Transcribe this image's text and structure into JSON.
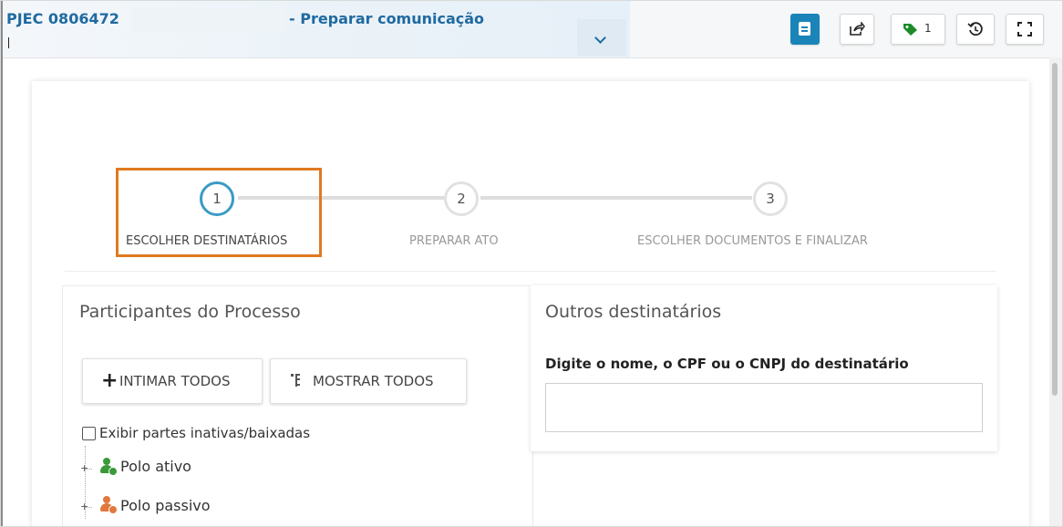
{
  "header": {
    "process_number": "PJEC 0806472",
    "task_title": "- Preparar comunicação",
    "tags_count": "1"
  },
  "toolbar": {
    "icons": [
      "document-icon",
      "share-icon",
      "tag-icon",
      "history-icon",
      "fullscreen-icon"
    ],
    "accent_color": "#1a84b8",
    "tag_color": "#1c8c2a"
  },
  "stepper": {
    "steps": [
      {
        "number": "1",
        "label": "ESCOLHER DESTINATÁRIOS",
        "active": true
      },
      {
        "number": "2",
        "label": "PREPARAR ATO",
        "active": false
      },
      {
        "number": "3",
        "label": "ESCOLHER DOCUMENTOS E FINALIZAR",
        "active": false
      }
    ],
    "highlight_color": "#e07a20"
  },
  "participants": {
    "title": "Participantes do Processo",
    "intimar_label": "INTIMAR TODOS",
    "mostrar_label": "MOSTRAR TODOS",
    "checkbox_label": "Exibir partes inativas/baixadas",
    "checkbox_checked": false,
    "tree": [
      {
        "label": "Polo ativo",
        "color": "#3a9a3a"
      },
      {
        "label": "Polo passivo",
        "color": "#e0783e"
      }
    ]
  },
  "outros": {
    "title": "Outros destinatários",
    "field_label": "Digite o nome, o CPF ou o CNPJ do destinatário",
    "field_value": "",
    "field_placeholder": ""
  }
}
